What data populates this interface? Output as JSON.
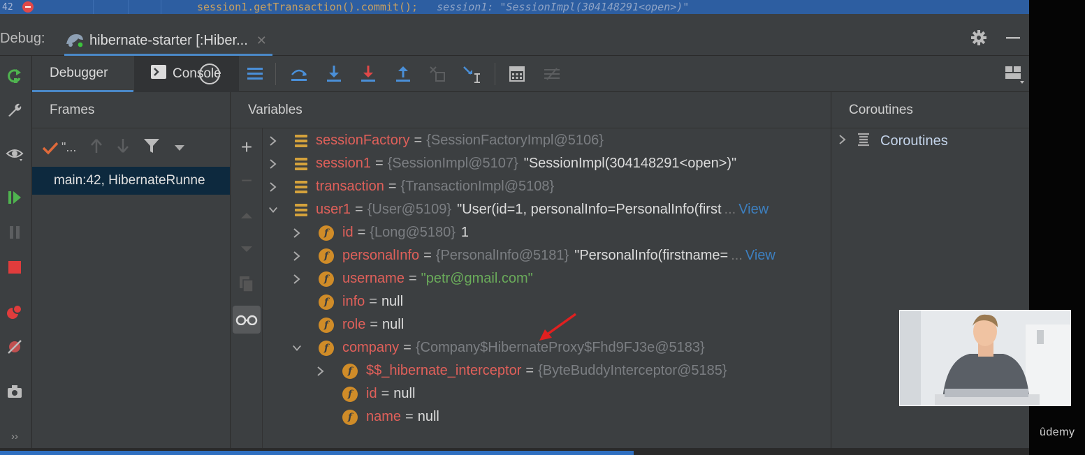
{
  "editor": {
    "line_number": "42",
    "code": "session1.getTransaction().commit();",
    "inline_value": "session1: \"SessionImpl(304148291<open>)\""
  },
  "debug_header": {
    "label": "Debug:",
    "run_config": "hibernate-starter [:Hiber...",
    "close_icon": "close-icon",
    "settings_icon": "gear-icon",
    "minimize_icon": "minimize-icon"
  },
  "toolbar": {
    "tabs": [
      "Debugger",
      "Console"
    ],
    "active_tab": "Debugger"
  },
  "frames": {
    "title": "Frames",
    "thread_label": "\"...",
    "items": [
      "main:42, HibernateRunne"
    ]
  },
  "variables": {
    "title": "Variables",
    "rows": [
      {
        "name": "sessionFactory",
        "type": "{SessionFactoryImpl@5106}",
        "value": "",
        "expand": "collapsed",
        "icon": "list"
      },
      {
        "name": "session1",
        "type": "{SessionImpl@5107}",
        "value": "\"SessionImpl(304148291<open>)\"",
        "expand": "collapsed",
        "icon": "list"
      },
      {
        "name": "transaction",
        "type": "{TransactionImpl@5108}",
        "value": "",
        "expand": "collapsed",
        "icon": "list"
      },
      {
        "name": "user1",
        "type": "{User@5109}",
        "value": "\"User(id=1, personalInfo=PersonalInfo(first",
        "ellipsis": "...",
        "view": "View",
        "expand": "expanded",
        "icon": "list"
      },
      {
        "name": "id",
        "type": "{Long@5180}",
        "value": "1",
        "expand": "collapsed",
        "icon": "field"
      },
      {
        "name": "personalInfo",
        "type": "{PersonalInfo@5181}",
        "value": "\"PersonalInfo(firstname=",
        "ellipsis": "...",
        "view": "View",
        "expand": "collapsed",
        "icon": "field"
      },
      {
        "name": "username",
        "type": "",
        "value": "\"petr@gmail.com\"",
        "expand": "collapsed",
        "icon": "field"
      },
      {
        "name": "info",
        "type": "",
        "value": "null",
        "expand": "none",
        "icon": "field"
      },
      {
        "name": "role",
        "type": "",
        "value": "null",
        "expand": "none",
        "icon": "field"
      },
      {
        "name": "company",
        "type": "{Company$HibernateProxy$Fhd9FJ3e@5183}",
        "value": "",
        "expand": "expanded",
        "icon": "field"
      },
      {
        "name": "$$_hibernate_interceptor",
        "type": "{ByteBuddyInterceptor@5185}",
        "value": "",
        "expand": "collapsed",
        "icon": "field"
      },
      {
        "name": "id",
        "type": "",
        "value": "null",
        "expand": "none",
        "icon": "field"
      },
      {
        "name": "name",
        "type": "",
        "value": "null",
        "expand": "none",
        "icon": "field"
      }
    ]
  },
  "coroutines": {
    "title": "Coroutines",
    "items": [
      "Coroutines"
    ]
  },
  "overlay": {
    "brand": "ûdemy",
    "progress": 0.584
  },
  "colors": {
    "accent": "#4a88c7",
    "field_name": "#e0605a",
    "string_value": "#6aab5a",
    "type_text": "#7b7e82",
    "link": "#3d7fbf"
  }
}
